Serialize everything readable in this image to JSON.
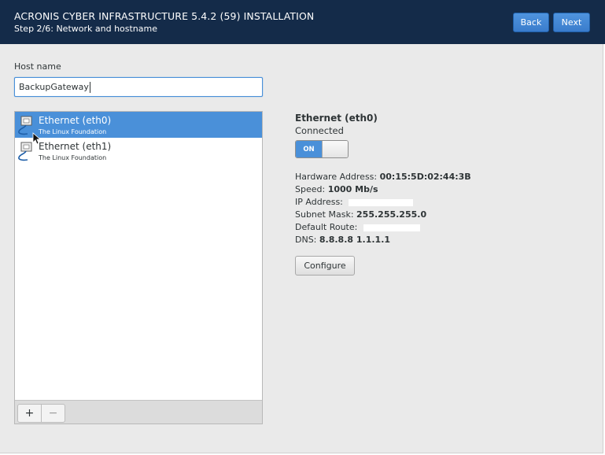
{
  "header": {
    "title": "ACRONIS CYBER INFRASTRUCTURE 5.4.2 (59) INSTALLATION",
    "step": "Step 2/6: Network and hostname",
    "back_label": "Back",
    "next_label": "Next"
  },
  "hostname": {
    "label": "Host name",
    "value": "BackupGateway"
  },
  "interfaces": [
    {
      "name": "Ethernet (eth0)",
      "vendor": "The Linux Foundation",
      "selected": true,
      "icon": "network-wired-icon"
    },
    {
      "name": "Ethernet (eth1)",
      "vendor": "The Linux Foundation",
      "selected": false,
      "icon": "network-wired-icon"
    }
  ],
  "toolbar": {
    "add_label": "+",
    "remove_label": "−"
  },
  "detail": {
    "title": "Ethernet (eth0)",
    "status": "Connected",
    "toggle_label": "ON",
    "hardware_label": "Hardware Address:",
    "hardware_value": "00:15:5D:02:44:3B",
    "speed_label": "Speed:",
    "speed_value": "1000 Mb/s",
    "ip_label": "IP Address:",
    "subnet_label": "Subnet Mask:",
    "subnet_value": "255.255.255.0",
    "route_label": "Default Route:",
    "dns_label": "DNS:",
    "dns_value": "8.8.8.8 1.1.1.1",
    "configure_label": "Configure"
  },
  "colors": {
    "header_bg": "#142b49",
    "accent": "#4a90d9",
    "content_bg": "#eaeaea"
  }
}
